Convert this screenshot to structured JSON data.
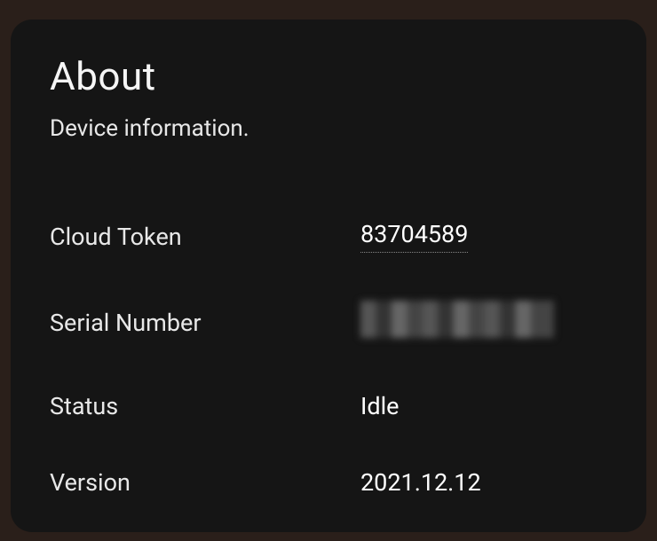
{
  "header": {
    "title": "About",
    "subtitle": "Device information."
  },
  "rows": {
    "cloud_token": {
      "label": "Cloud Token",
      "value": "83704589"
    },
    "serial_number": {
      "label": "Serial Number"
    },
    "status": {
      "label": "Status",
      "value": "Idle"
    },
    "version": {
      "label": "Version",
      "value": "2021.12.12"
    }
  }
}
